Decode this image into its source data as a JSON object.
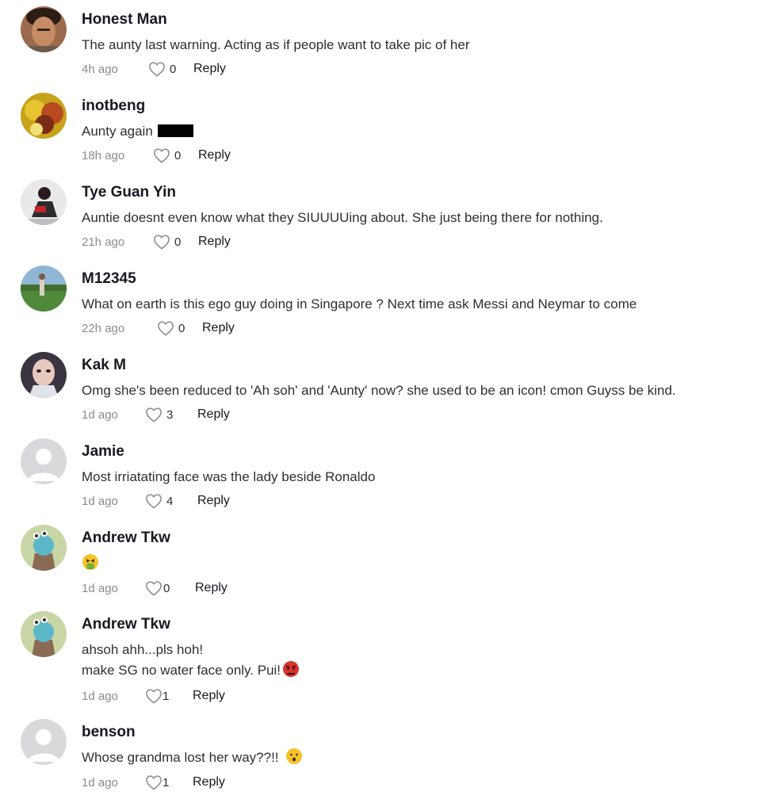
{
  "comments": [
    {
      "username": "Honest Man",
      "lines": [
        "The aunty last warning. Acting as if people want to take pic of her"
      ],
      "time": "4h ago",
      "likes": "0",
      "reply_label": "Reply",
      "avatar_icon": "photo-avatar-man"
    },
    {
      "username": "inotbeng",
      "lines": [
        "Aunty again"
      ],
      "time": "18h ago",
      "likes": "0",
      "reply_label": "Reply",
      "avatar_icon": "photo-avatar-lion-dance",
      "redacted": true
    },
    {
      "username": "Tye Guan Yin",
      "lines": [
        "Auntie doesnt even know what they SIUUUUing about. She just being there for nothing."
      ],
      "time": "21h ago",
      "likes": "0",
      "reply_label": "Reply",
      "avatar_icon": "photo-avatar-person"
    },
    {
      "username": "M12345",
      "lines": [
        "What on earth is this ego guy doing in Singapore ? Next time ask Messi and Neymar to come"
      ],
      "time": "22h ago",
      "likes": "0",
      "reply_label": "Reply",
      "avatar_icon": "photo-avatar-golf"
    },
    {
      "username": "Kak M",
      "lines": [
        "Omg she's been reduced to 'Ah soh' and 'Aunty' now? she used to be an icon! cmon Guyss be kind."
      ],
      "time": "1d ago",
      "likes": "3",
      "reply_label": "Reply",
      "avatar_icon": "photo-avatar-woman"
    },
    {
      "username": "Jamie",
      "lines": [
        "Most irriatating face was the lady beside Ronaldo"
      ],
      "time": "1d ago",
      "likes": "4",
      "reply_label": "Reply",
      "avatar_icon": "default-avatar-icon"
    },
    {
      "username": "Andrew Tkw",
      "lines": [
        ""
      ],
      "time": "1d ago",
      "likes": "0",
      "reply_label": "Reply",
      "avatar_icon": "cartoon-avatar",
      "emoji": "face-vomiting-emoji"
    },
    {
      "username": "Andrew Tkw",
      "lines": [
        "ahsoh ahh...pls hoh!",
        "make SG no water face only. Pui!"
      ],
      "time": "1d ago",
      "likes": "1",
      "reply_label": "Reply",
      "avatar_icon": "cartoon-avatar",
      "emoji": "angry-face-emoji"
    },
    {
      "username": "benson",
      "lines": [
        "Whose grandma lost her way??!!"
      ],
      "time": "1d ago",
      "likes": "1",
      "reply_label": "Reply",
      "avatar_icon": "default-avatar-icon",
      "emoji": "confused-face-emoji"
    }
  ],
  "colors": {
    "username": "#161823",
    "text": "#2f2f34",
    "meta": "#8a8b91",
    "heart_stroke": "#8a8b91"
  }
}
